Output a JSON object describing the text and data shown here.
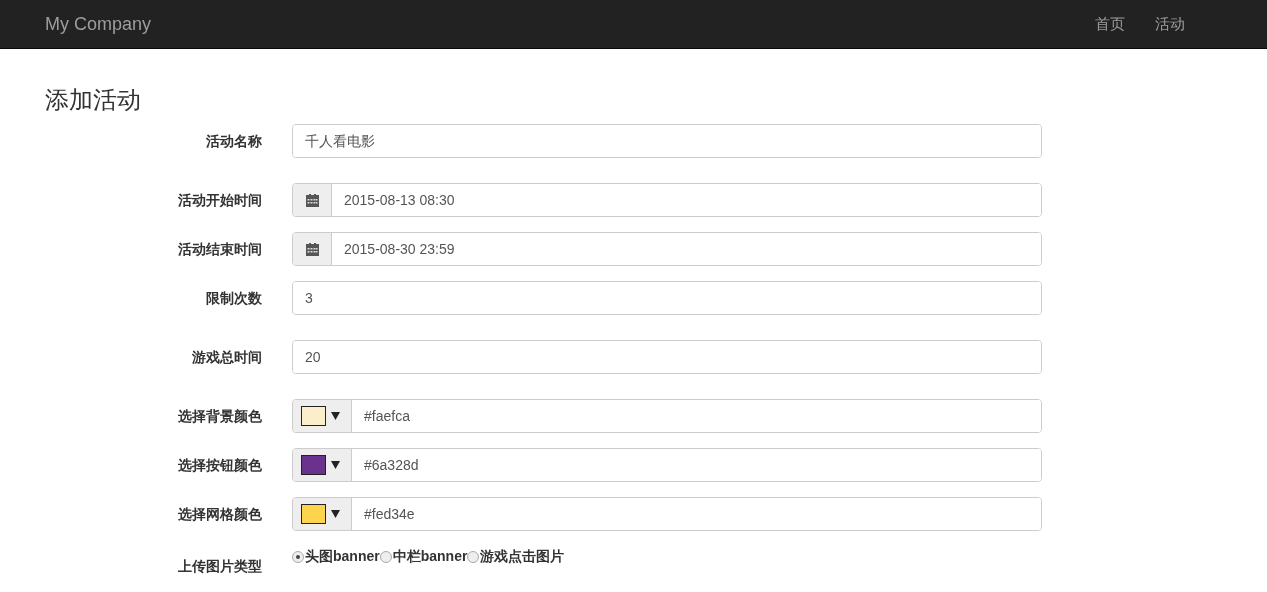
{
  "navbar": {
    "brand": "My Company",
    "links": [
      {
        "label": "首页"
      },
      {
        "label": "活动"
      }
    ]
  },
  "page_title": "添加活动",
  "fields": [
    {
      "kind": "text",
      "label": "活动名称",
      "value": "千人看电影"
    },
    {
      "kind": "date",
      "label": "活动开始时间",
      "value": "2015-08-13 08:30"
    },
    {
      "kind": "date",
      "label": "活动结束时间",
      "value": "2015-08-30 23:59"
    },
    {
      "kind": "text",
      "label": "限制次数",
      "value": "3"
    },
    {
      "kind": "text",
      "label": "游戏总时间",
      "value": "20"
    },
    {
      "kind": "color",
      "label": "选择背景颜色",
      "value": "#faefca",
      "color": "#faefca"
    },
    {
      "kind": "color",
      "label": "选择按钮颜色",
      "value": "#6a328d",
      "color": "#6a328d"
    },
    {
      "kind": "color",
      "label": "选择网格颜色",
      "value": "#fed34e",
      "color": "#fed34e"
    }
  ],
  "upload_type": {
    "label": "上传图片类型",
    "options": [
      {
        "label": "头图banner",
        "selected": true
      },
      {
        "label": "中栏banner",
        "selected": false
      },
      {
        "label": "游戏点击图片",
        "selected": false
      }
    ]
  }
}
